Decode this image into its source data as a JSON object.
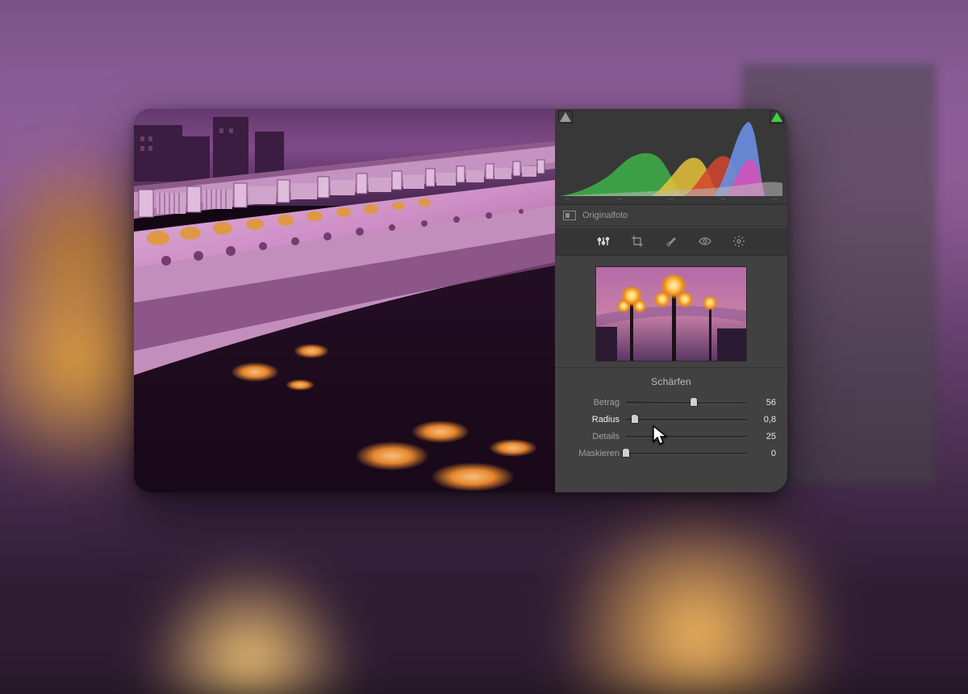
{
  "originalfoto_label": "Originalfoto",
  "tools": [
    "sliders",
    "crop",
    "brush",
    "eye",
    "radial"
  ],
  "panel": {
    "title": "Schärfen",
    "sliders": [
      {
        "label": "Betrag",
        "value": "56",
        "pos": 56,
        "grad": true,
        "active": false
      },
      {
        "label": "Radius",
        "value": "0,8",
        "pos": 7,
        "grad": false,
        "active": true
      },
      {
        "label": "Details",
        "value": "25",
        "pos": 25,
        "grad": false,
        "active": false
      },
      {
        "label": "Maskieren",
        "value": "0",
        "pos": 0,
        "grad": false,
        "active": false
      }
    ]
  },
  "hist_ticks": [
    "–",
    "–",
    "–",
    "–",
    "–"
  ]
}
